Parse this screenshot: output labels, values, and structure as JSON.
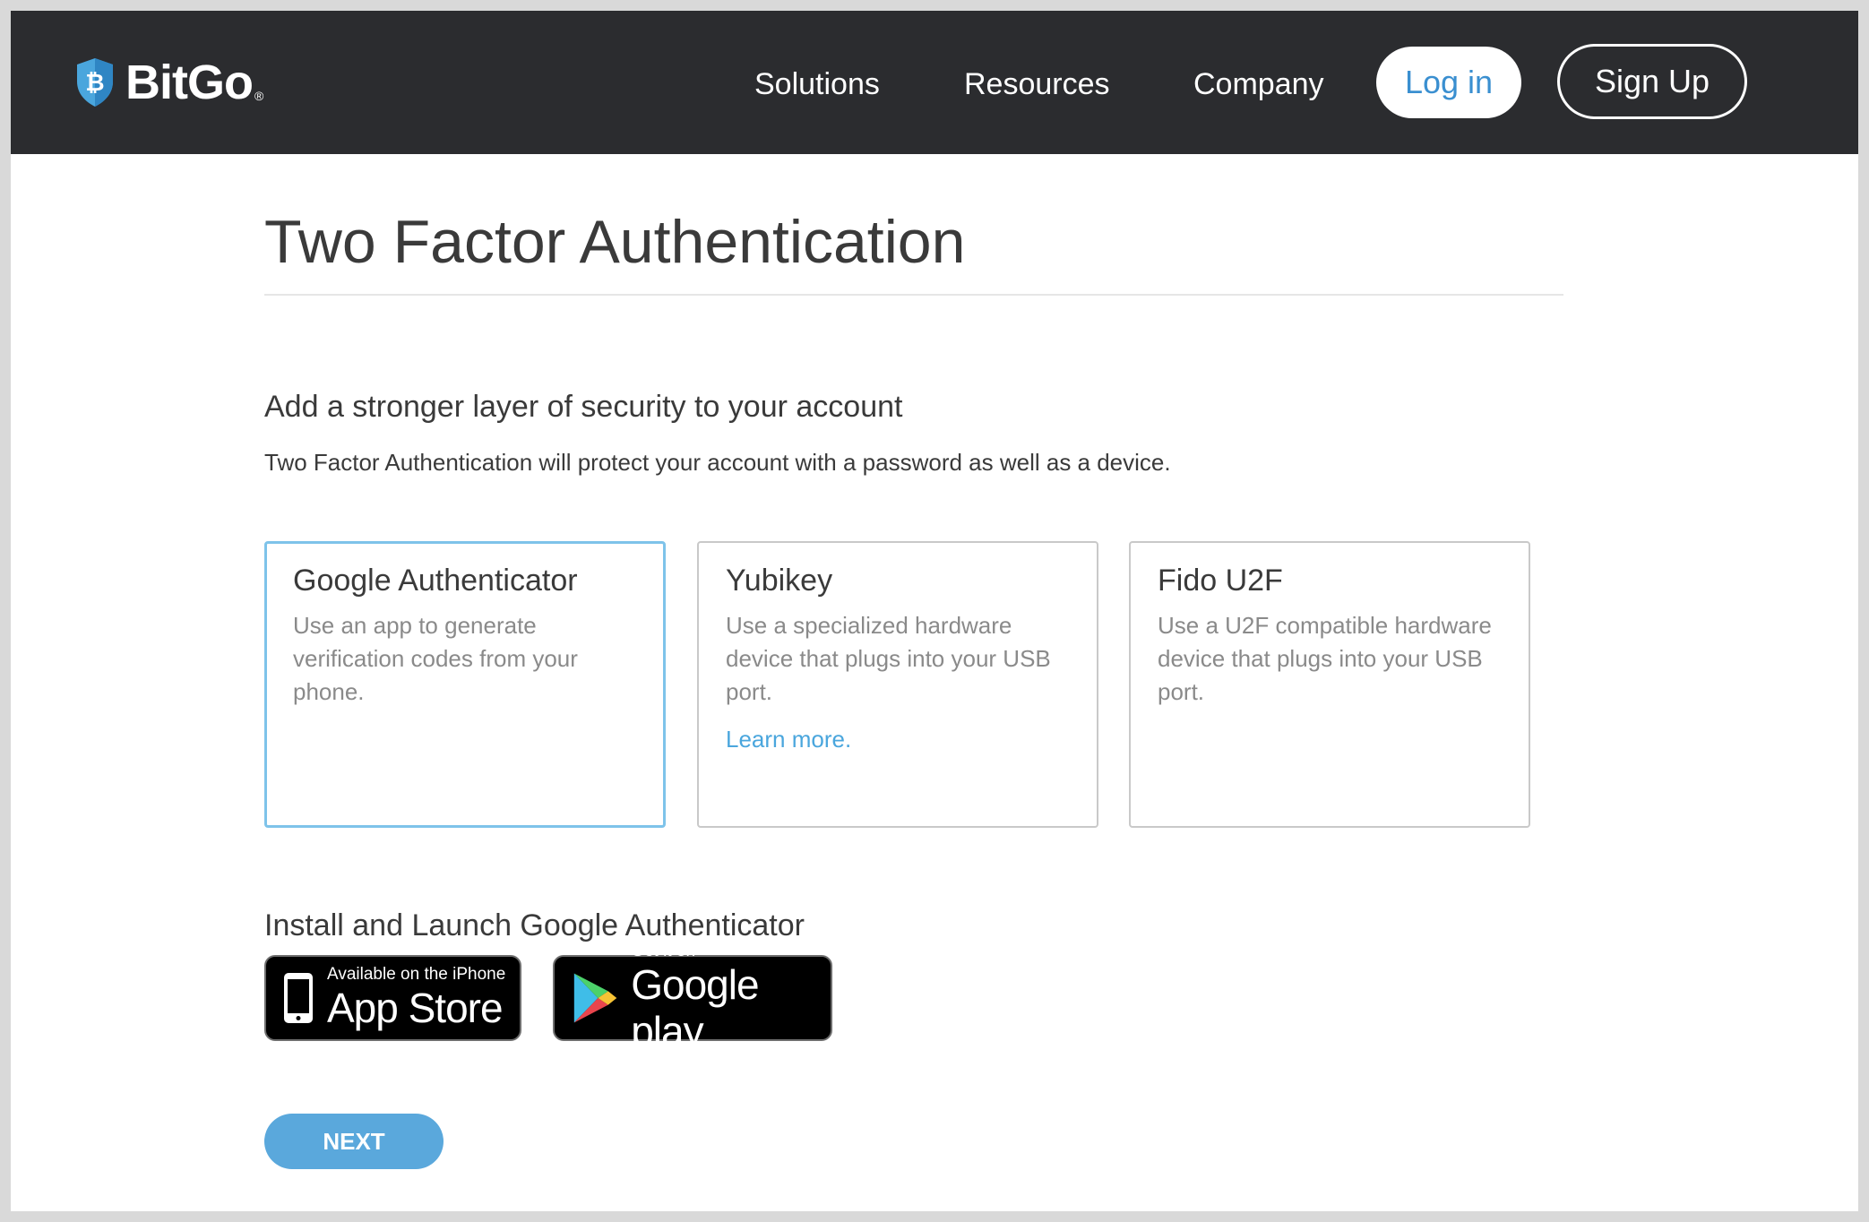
{
  "header": {
    "logo_text": "BitGo",
    "logo_reg": "®",
    "nav": [
      "Solutions",
      "Resources",
      "Company"
    ],
    "login_label": "Log in",
    "signup_label": "Sign Up"
  },
  "main": {
    "title": "Two Factor Authentication",
    "subheading": "Add a stronger layer of security to your account",
    "description": "Two Factor Authentication will protect your account with a password as well as a device.",
    "options": [
      {
        "title": "Google Authenticator",
        "description": "Use an app to generate verification codes from your phone.",
        "selected": true
      },
      {
        "title": "Yubikey",
        "description": "Use a specialized hardware device that plugs into your USB port.",
        "link": "Learn more."
      },
      {
        "title": "Fido U2F",
        "description": "Use a U2F compatible hardware device that plugs into your USB port."
      }
    ],
    "install_heading": "Install and Launch Google Authenticator",
    "app_store": {
      "small": "Available on the iPhone",
      "big": "App Store"
    },
    "google_play": {
      "small": "Get it on",
      "big": "Google play"
    },
    "next_label": "NEXT"
  },
  "colors": {
    "header_bg": "#2b2c2f",
    "accent": "#4aa6dd",
    "selected_border": "#7ec3ea",
    "next_button": "#5aa8dc"
  }
}
